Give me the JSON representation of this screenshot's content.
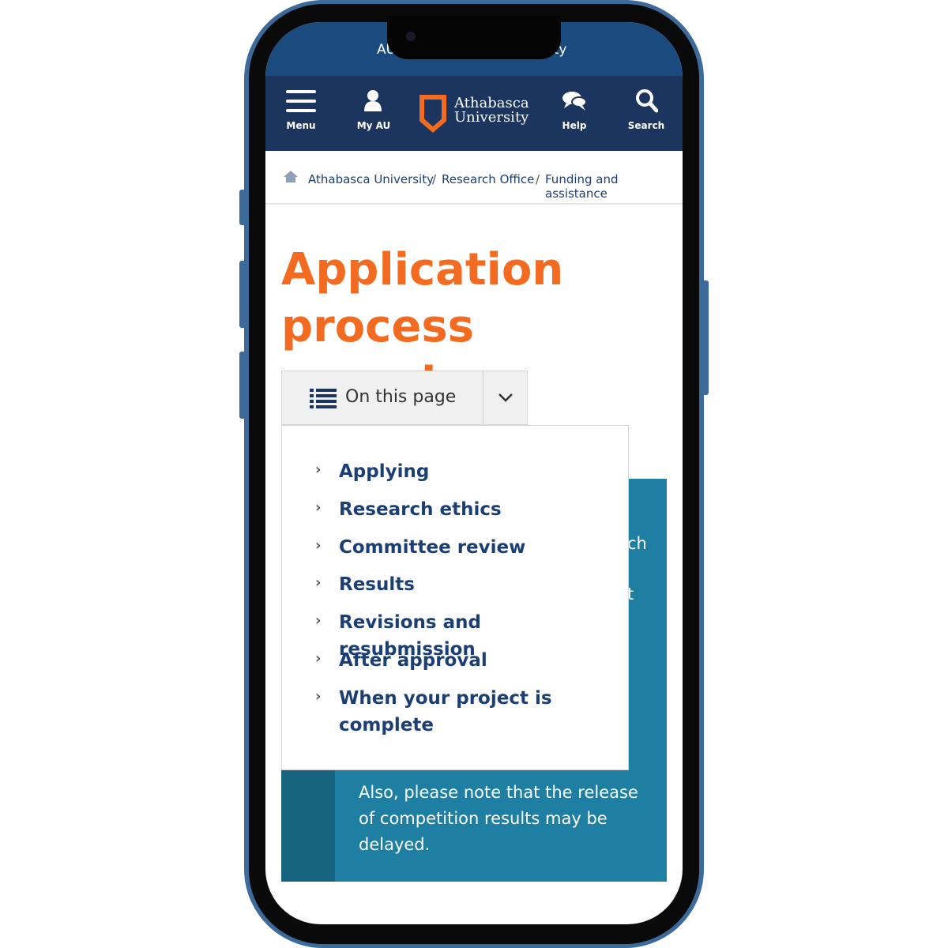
{
  "status_bar": {
    "left_fragment": "AU",
    "right_fragment": "ity"
  },
  "nav": {
    "menu": "Menu",
    "my_au": "My AU",
    "logo_line1": "Athabasca",
    "logo_line2": "University",
    "help": "Help",
    "search": "Search"
  },
  "breadcrumb": [
    "Athabasca University",
    "Research Office",
    "Funding and assistance"
  ],
  "page": {
    "title": "Application process overview"
  },
  "on_this_page": {
    "label": "On this page",
    "items": [
      "Applying",
      "Research ethics",
      "Committee review",
      "Results",
      "Revisions and resubmission",
      "After approval",
      "When your project is complete"
    ]
  },
  "callout": {
    "hidden_fragment_1": "ch",
    "hidden_fragment_2": "t",
    "text": "Also, please note that the release of competition results may be delayed."
  },
  "colors": {
    "nav": "#1c355e",
    "accent": "#f26b21",
    "link": "#1c3f73",
    "callout": "#1e7fa2"
  }
}
